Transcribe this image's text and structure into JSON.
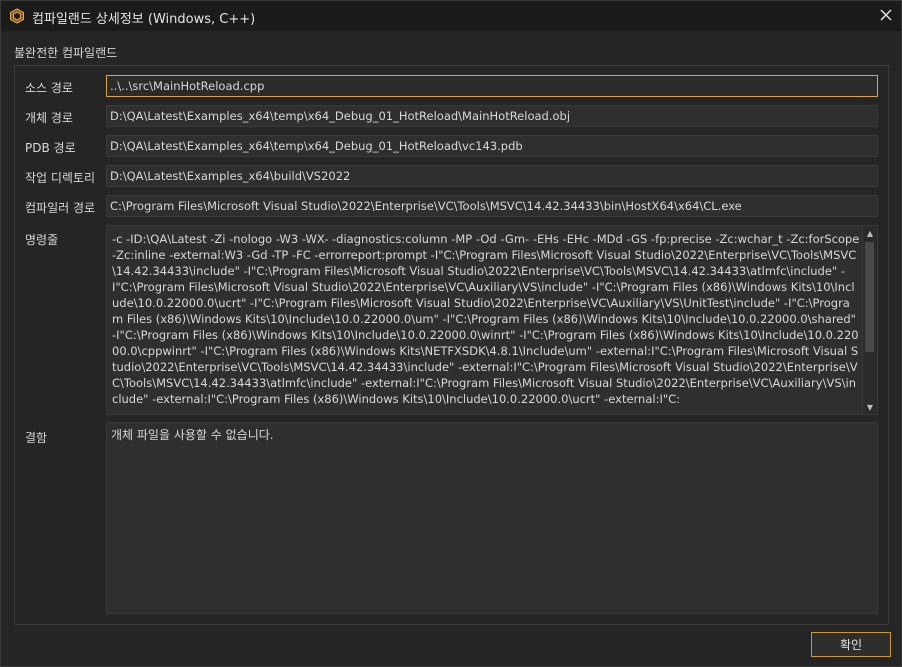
{
  "window": {
    "title": "컴파일랜드 상세정보 (Windows, C++)",
    "close_icon": "close-icon",
    "app_icon": "compiland-icon"
  },
  "group": {
    "label": "불완전한 컴파일랜드"
  },
  "fields": {
    "source_path": {
      "label": "소스 경로",
      "value": "..\\..\\src\\MainHotReload.cpp"
    },
    "object_path": {
      "label": "개체 경로",
      "value": "D:\\QA\\Latest\\Examples_x64\\temp\\x64_Debug_01_HotReload\\MainHotReload.obj"
    },
    "pdb_path": {
      "label": "PDB 경로",
      "value": "D:\\QA\\Latest\\Examples_x64\\temp\\x64_Debug_01_HotReload\\vc143.pdb"
    },
    "working_dir": {
      "label": "작업 디렉토리",
      "value": "D:\\QA\\Latest\\Examples_x64\\build\\VS2022"
    },
    "compiler_path": {
      "label": "컴파일러 경로",
      "value": "C:\\Program Files\\Microsoft Visual Studio\\2022\\Enterprise\\VC\\Tools\\MSVC\\14.42.34433\\bin\\HostX64\\x64\\CL.exe"
    }
  },
  "command_line": {
    "label": "명령줄",
    "value": "-c -ID:\\QA\\Latest -Zi -nologo -W3 -WX- -diagnostics:column -MP -Od -Gm- -EHs -EHc -MDd -GS -fp:precise -Zc:wchar_t -Zc:forScope -Zc:inline -external:W3 -Gd -TP -FC -errorreport:prompt -I\"C:\\Program Files\\Microsoft Visual Studio\\2022\\Enterprise\\VC\\Tools\\MSVC\\14.42.34433\\include\" -I\"C:\\Program Files\\Microsoft Visual Studio\\2022\\Enterprise\\VC\\Tools\\MSVC\\14.42.34433\\atlmfc\\include\" -I\"C:\\Program Files\\Microsoft Visual Studio\\2022\\Enterprise\\VC\\Auxiliary\\VS\\include\" -I\"C:\\Program Files (x86)\\Windows Kits\\10\\Include\\10.0.22000.0\\ucrt\" -I\"C:\\Program Files\\Microsoft Visual Studio\\2022\\Enterprise\\VC\\Auxiliary\\VS\\UnitTest\\include\" -I\"C:\\Program Files (x86)\\Windows Kits\\10\\Include\\10.0.22000.0\\um\" -I\"C:\\Program Files (x86)\\Windows Kits\\10\\Include\\10.0.22000.0\\shared\" -I\"C:\\Program Files (x86)\\Windows Kits\\10\\Include\\10.0.22000.0\\winrt\" -I\"C:\\Program Files (x86)\\Windows Kits\\10\\Include\\10.0.22000.0\\cppwinrt\" -I\"C:\\Program Files (x86)\\Windows Kits\\NETFXSDK\\4.8.1\\Include\\um\" -external:I\"C:\\Program Files\\Microsoft Visual Studio\\2022\\Enterprise\\VC\\Tools\\MSVC\\14.42.34433\\include\" -external:I\"C:\\Program Files\\Microsoft Visual Studio\\2022\\Enterprise\\VC\\Tools\\MSVC\\14.42.34433\\atlmfc\\include\" -external:I\"C:\\Program Files\\Microsoft Visual Studio\\2022\\Enterprise\\VC\\Auxiliary\\VS\\include\" -external:I\"C:\\Program Files (x86)\\Windows Kits\\10\\Include\\10.0.22000.0\\ucrt\" -external:I\"C:"
  },
  "result": {
    "label": "결함",
    "value": "개체 파일을 사용할 수 없습니다."
  },
  "buttons": {
    "ok_label": "확인"
  },
  "colors": {
    "accent": "#d9a441",
    "background": "#252526"
  }
}
